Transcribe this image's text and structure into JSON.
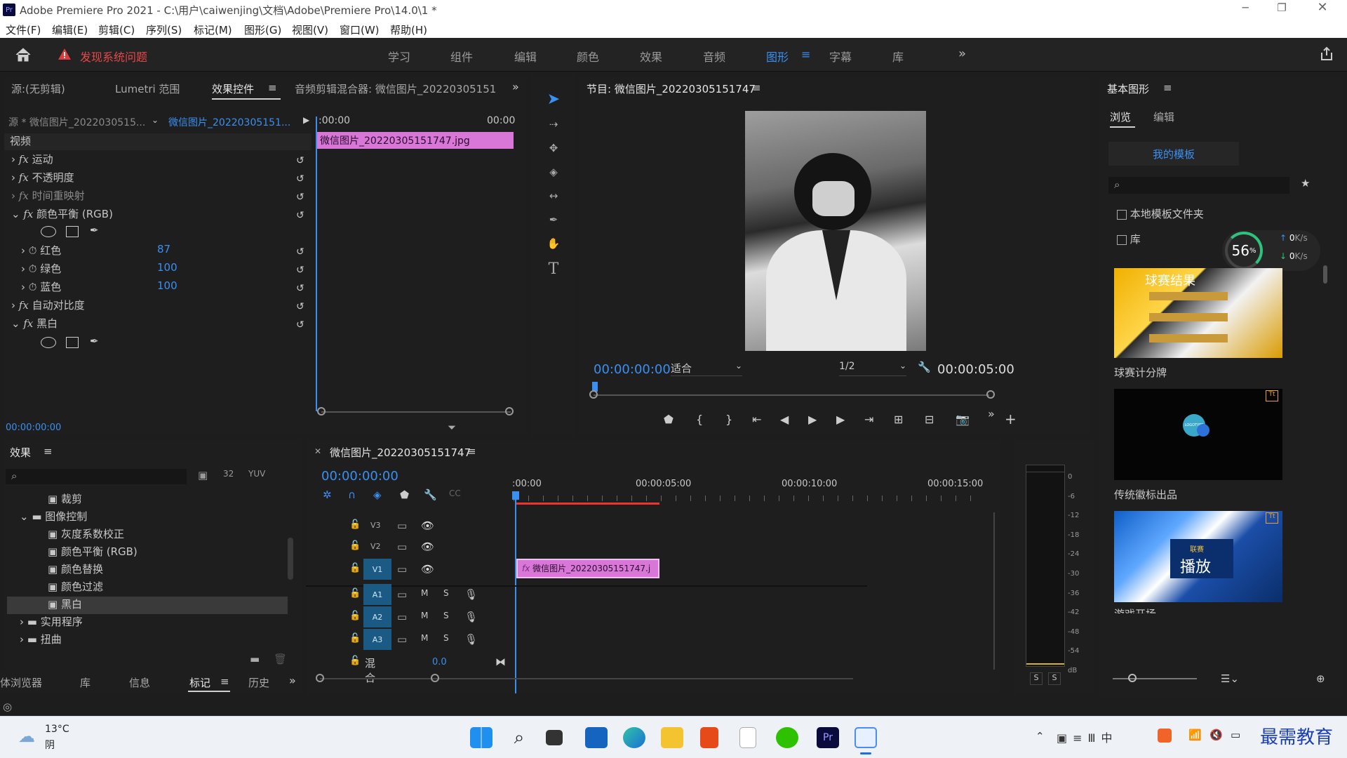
{
  "window": {
    "title": "Adobe Premiere Pro 2021 - C:\\用户\\caiwenjing\\文档\\Adobe\\Premiere Pro\\14.0\\1 *",
    "app_badge": "Pr"
  },
  "menu": [
    "文件(F)",
    "编辑(E)",
    "剪辑(C)",
    "序列(S)",
    "标记(M)",
    "图形(G)",
    "视图(V)",
    "窗口(W)",
    "帮助(H)"
  ],
  "alert": {
    "text": "发现系统问题"
  },
  "workspaces": [
    "学习",
    "组件",
    "编辑",
    "颜色",
    "效果",
    "音频",
    "图形",
    "字幕",
    "库"
  ],
  "workspace_active": "图形",
  "source_panel": {
    "tabs": [
      "源:(无剪辑)",
      "Lumetri 范围",
      "效果控件",
      "音频剪辑混合器: 微信图片_20220305151"
    ],
    "master_clip": "源 * 微信图片_2022030515...",
    "seq_clip": "微信图片_20220305151...",
    "time_start": ":00:00",
    "time_end": "00:00",
    "clip_bar": "微信图片_20220305151747.jpg",
    "section": "视频",
    "effects": [
      {
        "name": "运动"
      },
      {
        "name": "不透明度"
      },
      {
        "name": "时间重映射"
      },
      {
        "name": "颜色平衡 (RGB)"
      }
    ],
    "params": [
      {
        "name": "红色",
        "value": "87"
      },
      {
        "name": "绿色",
        "value": "100"
      },
      {
        "name": "蓝色",
        "value": "100"
      }
    ],
    "effects2": [
      {
        "name": "自动对比度"
      },
      {
        "name": "黑白"
      }
    ],
    "footer_time": "00:00:00:00"
  },
  "program_monitor": {
    "title": "节目: 微信图片_20220305151747",
    "timecode": "00:00:00:00",
    "fit": "适合",
    "resolution": "1/2",
    "duration": "00:00:05:00"
  },
  "essential_graphics": {
    "title": "基本图形",
    "tabs": [
      "浏览",
      "编辑"
    ],
    "my_templates": "我的模板",
    "local_folder": "本地模板文件夹",
    "library": "库",
    "templates": [
      {
        "name": "球赛计分牌",
        "overlay_title": "球赛结果"
      },
      {
        "name": "传统徽标出品",
        "logo_text": "LOGOTYPE"
      },
      {
        "name": "游戏开场",
        "overlay_title": "播放",
        "overlay_sub": "联赛"
      }
    ],
    "speed_widget": {
      "percent": "56",
      "up": "0",
      "down": "0",
      "unit": "K/s"
    }
  },
  "effects_panel": {
    "title": "效果",
    "tree": [
      {
        "label": "裁剪",
        "type": "item"
      },
      {
        "label": "图像控制",
        "type": "folder-open"
      },
      {
        "label": "灰度系数校正",
        "type": "item"
      },
      {
        "label": "颜色平衡 (RGB)",
        "type": "item"
      },
      {
        "label": "颜色替换",
        "type": "item"
      },
      {
        "label": "颜色过滤",
        "type": "item"
      },
      {
        "label": "黑白",
        "type": "item-selected"
      },
      {
        "label": "实用程序",
        "type": "folder"
      },
      {
        "label": "扭曲",
        "type": "folder"
      }
    ],
    "bottom_tabs": [
      "体浏览器",
      "库",
      "信息",
      "标记",
      "历史"
    ]
  },
  "timeline": {
    "title": "微信图片_20220305151747",
    "timecode": "00:00:00:00",
    "ruler": [
      ":00:00",
      "00:00:05:00",
      "00:00:10:00",
      "00:00:15:00"
    ],
    "tracks_video": [
      "V3",
      "V2",
      "V1"
    ],
    "tracks_audio": [
      "A1",
      "A2",
      "A3"
    ],
    "mix_label": "混合",
    "mix_value": "0.0",
    "clip": "微信图片_20220305151747.j",
    "fx": "fx",
    "m": "M",
    "s": "S"
  },
  "meter": {
    "scale": [
      "0",
      "-6",
      "-12",
      "-18",
      "-24",
      "-30",
      "-36",
      "-42",
      "-48",
      "-54",
      "dB"
    ],
    "solo": [
      "S",
      "S"
    ]
  },
  "taskbar": {
    "temp": "13°C",
    "weather": "阴",
    "watermark": "最需教育"
  }
}
